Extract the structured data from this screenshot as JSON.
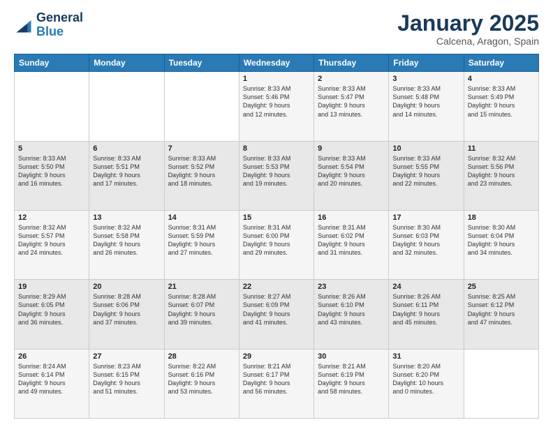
{
  "logo": {
    "general": "General",
    "blue": "Blue"
  },
  "header": {
    "title": "January 2025",
    "subtitle": "Calcena, Aragon, Spain"
  },
  "weekdays": [
    "Sunday",
    "Monday",
    "Tuesday",
    "Wednesday",
    "Thursday",
    "Friday",
    "Saturday"
  ],
  "weeks": [
    [
      {
        "day": "",
        "content": ""
      },
      {
        "day": "",
        "content": ""
      },
      {
        "day": "",
        "content": ""
      },
      {
        "day": "1",
        "content": "Sunrise: 8:33 AM\nSunset: 5:46 PM\nDaylight: 9 hours\nand 12 minutes."
      },
      {
        "day": "2",
        "content": "Sunrise: 8:33 AM\nSunset: 5:47 PM\nDaylight: 9 hours\nand 13 minutes."
      },
      {
        "day": "3",
        "content": "Sunrise: 8:33 AM\nSunset: 5:48 PM\nDaylight: 9 hours\nand 14 minutes."
      },
      {
        "day": "4",
        "content": "Sunrise: 8:33 AM\nSunset: 5:49 PM\nDaylight: 9 hours\nand 15 minutes."
      }
    ],
    [
      {
        "day": "5",
        "content": "Sunrise: 8:33 AM\nSunset: 5:50 PM\nDaylight: 9 hours\nand 16 minutes."
      },
      {
        "day": "6",
        "content": "Sunrise: 8:33 AM\nSunset: 5:51 PM\nDaylight: 9 hours\nand 17 minutes."
      },
      {
        "day": "7",
        "content": "Sunrise: 8:33 AM\nSunset: 5:52 PM\nDaylight: 9 hours\nand 18 minutes."
      },
      {
        "day": "8",
        "content": "Sunrise: 8:33 AM\nSunset: 5:53 PM\nDaylight: 9 hours\nand 19 minutes."
      },
      {
        "day": "9",
        "content": "Sunrise: 8:33 AM\nSunset: 5:54 PM\nDaylight: 9 hours\nand 20 minutes."
      },
      {
        "day": "10",
        "content": "Sunrise: 8:33 AM\nSunset: 5:55 PM\nDaylight: 9 hours\nand 22 minutes."
      },
      {
        "day": "11",
        "content": "Sunrise: 8:32 AM\nSunset: 5:56 PM\nDaylight: 9 hours\nand 23 minutes."
      }
    ],
    [
      {
        "day": "12",
        "content": "Sunrise: 8:32 AM\nSunset: 5:57 PM\nDaylight: 9 hours\nand 24 minutes."
      },
      {
        "day": "13",
        "content": "Sunrise: 8:32 AM\nSunset: 5:58 PM\nDaylight: 9 hours\nand 26 minutes."
      },
      {
        "day": "14",
        "content": "Sunrise: 8:31 AM\nSunset: 5:59 PM\nDaylight: 9 hours\nand 27 minutes."
      },
      {
        "day": "15",
        "content": "Sunrise: 8:31 AM\nSunset: 6:00 PM\nDaylight: 9 hours\nand 29 minutes."
      },
      {
        "day": "16",
        "content": "Sunrise: 8:31 AM\nSunset: 6:02 PM\nDaylight: 9 hours\nand 31 minutes."
      },
      {
        "day": "17",
        "content": "Sunrise: 8:30 AM\nSunset: 6:03 PM\nDaylight: 9 hours\nand 32 minutes."
      },
      {
        "day": "18",
        "content": "Sunrise: 8:30 AM\nSunset: 6:04 PM\nDaylight: 9 hours\nand 34 minutes."
      }
    ],
    [
      {
        "day": "19",
        "content": "Sunrise: 8:29 AM\nSunset: 6:05 PM\nDaylight: 9 hours\nand 36 minutes."
      },
      {
        "day": "20",
        "content": "Sunrise: 8:28 AM\nSunset: 6:06 PM\nDaylight: 9 hours\nand 37 minutes."
      },
      {
        "day": "21",
        "content": "Sunrise: 8:28 AM\nSunset: 6:07 PM\nDaylight: 9 hours\nand 39 minutes."
      },
      {
        "day": "22",
        "content": "Sunrise: 8:27 AM\nSunset: 6:09 PM\nDaylight: 9 hours\nand 41 minutes."
      },
      {
        "day": "23",
        "content": "Sunrise: 8:26 AM\nSunset: 6:10 PM\nDaylight: 9 hours\nand 43 minutes."
      },
      {
        "day": "24",
        "content": "Sunrise: 8:26 AM\nSunset: 6:11 PM\nDaylight: 9 hours\nand 45 minutes."
      },
      {
        "day": "25",
        "content": "Sunrise: 8:25 AM\nSunset: 6:12 PM\nDaylight: 9 hours\nand 47 minutes."
      }
    ],
    [
      {
        "day": "26",
        "content": "Sunrise: 8:24 AM\nSunset: 6:14 PM\nDaylight: 9 hours\nand 49 minutes."
      },
      {
        "day": "27",
        "content": "Sunrise: 8:23 AM\nSunset: 6:15 PM\nDaylight: 9 hours\nand 51 minutes."
      },
      {
        "day": "28",
        "content": "Sunrise: 8:22 AM\nSunset: 6:16 PM\nDaylight: 9 hours\nand 53 minutes."
      },
      {
        "day": "29",
        "content": "Sunrise: 8:21 AM\nSunset: 6:17 PM\nDaylight: 9 hours\nand 56 minutes."
      },
      {
        "day": "30",
        "content": "Sunrise: 8:21 AM\nSunset: 6:19 PM\nDaylight: 9 hours\nand 58 minutes."
      },
      {
        "day": "31",
        "content": "Sunrise: 8:20 AM\nSunset: 6:20 PM\nDaylight: 10 hours\nand 0 minutes."
      },
      {
        "day": "",
        "content": ""
      }
    ]
  ]
}
